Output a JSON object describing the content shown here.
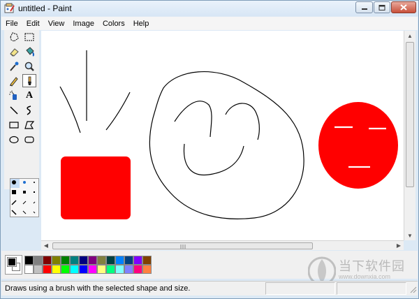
{
  "window": {
    "title": "untitled - Paint"
  },
  "menu": {
    "items": [
      "File",
      "Edit",
      "View",
      "Image",
      "Colors",
      "Help"
    ]
  },
  "toolbox": {
    "tools": [
      "free-form-select-icon",
      "select-icon",
      "eraser-icon",
      "fill-icon",
      "pick-color-icon",
      "magnifier-icon",
      "pencil-icon",
      "brush-icon",
      "airbrush-icon",
      "text-icon",
      "line-icon",
      "curve-icon",
      "rectangle-icon",
      "polygon-icon",
      "ellipse-icon",
      "rounded-rectangle-icon"
    ],
    "selected_tool": "brush-icon",
    "text_tool_glyph": "A"
  },
  "palette": {
    "foreground": "#000000",
    "background": "#ffffff",
    "colors": [
      "#000000",
      "#808080",
      "#800000",
      "#808000",
      "#008000",
      "#008080",
      "#000080",
      "#800080",
      "#808040",
      "#004040",
      "#0080ff",
      "#004080",
      "#8000ff",
      "#804000",
      "#ffffff",
      "#c0c0c0",
      "#ff0000",
      "#ffff00",
      "#00ff00",
      "#00ffff",
      "#0000ff",
      "#ff00ff",
      "#ffff80",
      "#00ff80",
      "#80ffff",
      "#8080ff",
      "#ff0080",
      "#ff8040"
    ]
  },
  "status": {
    "text": "Draws using a brush with the selected shape and size."
  },
  "watermark": {
    "line1": "当下软件园",
    "line2": "www.downxia.com"
  },
  "drawing": {
    "accent": "#ff0000"
  }
}
